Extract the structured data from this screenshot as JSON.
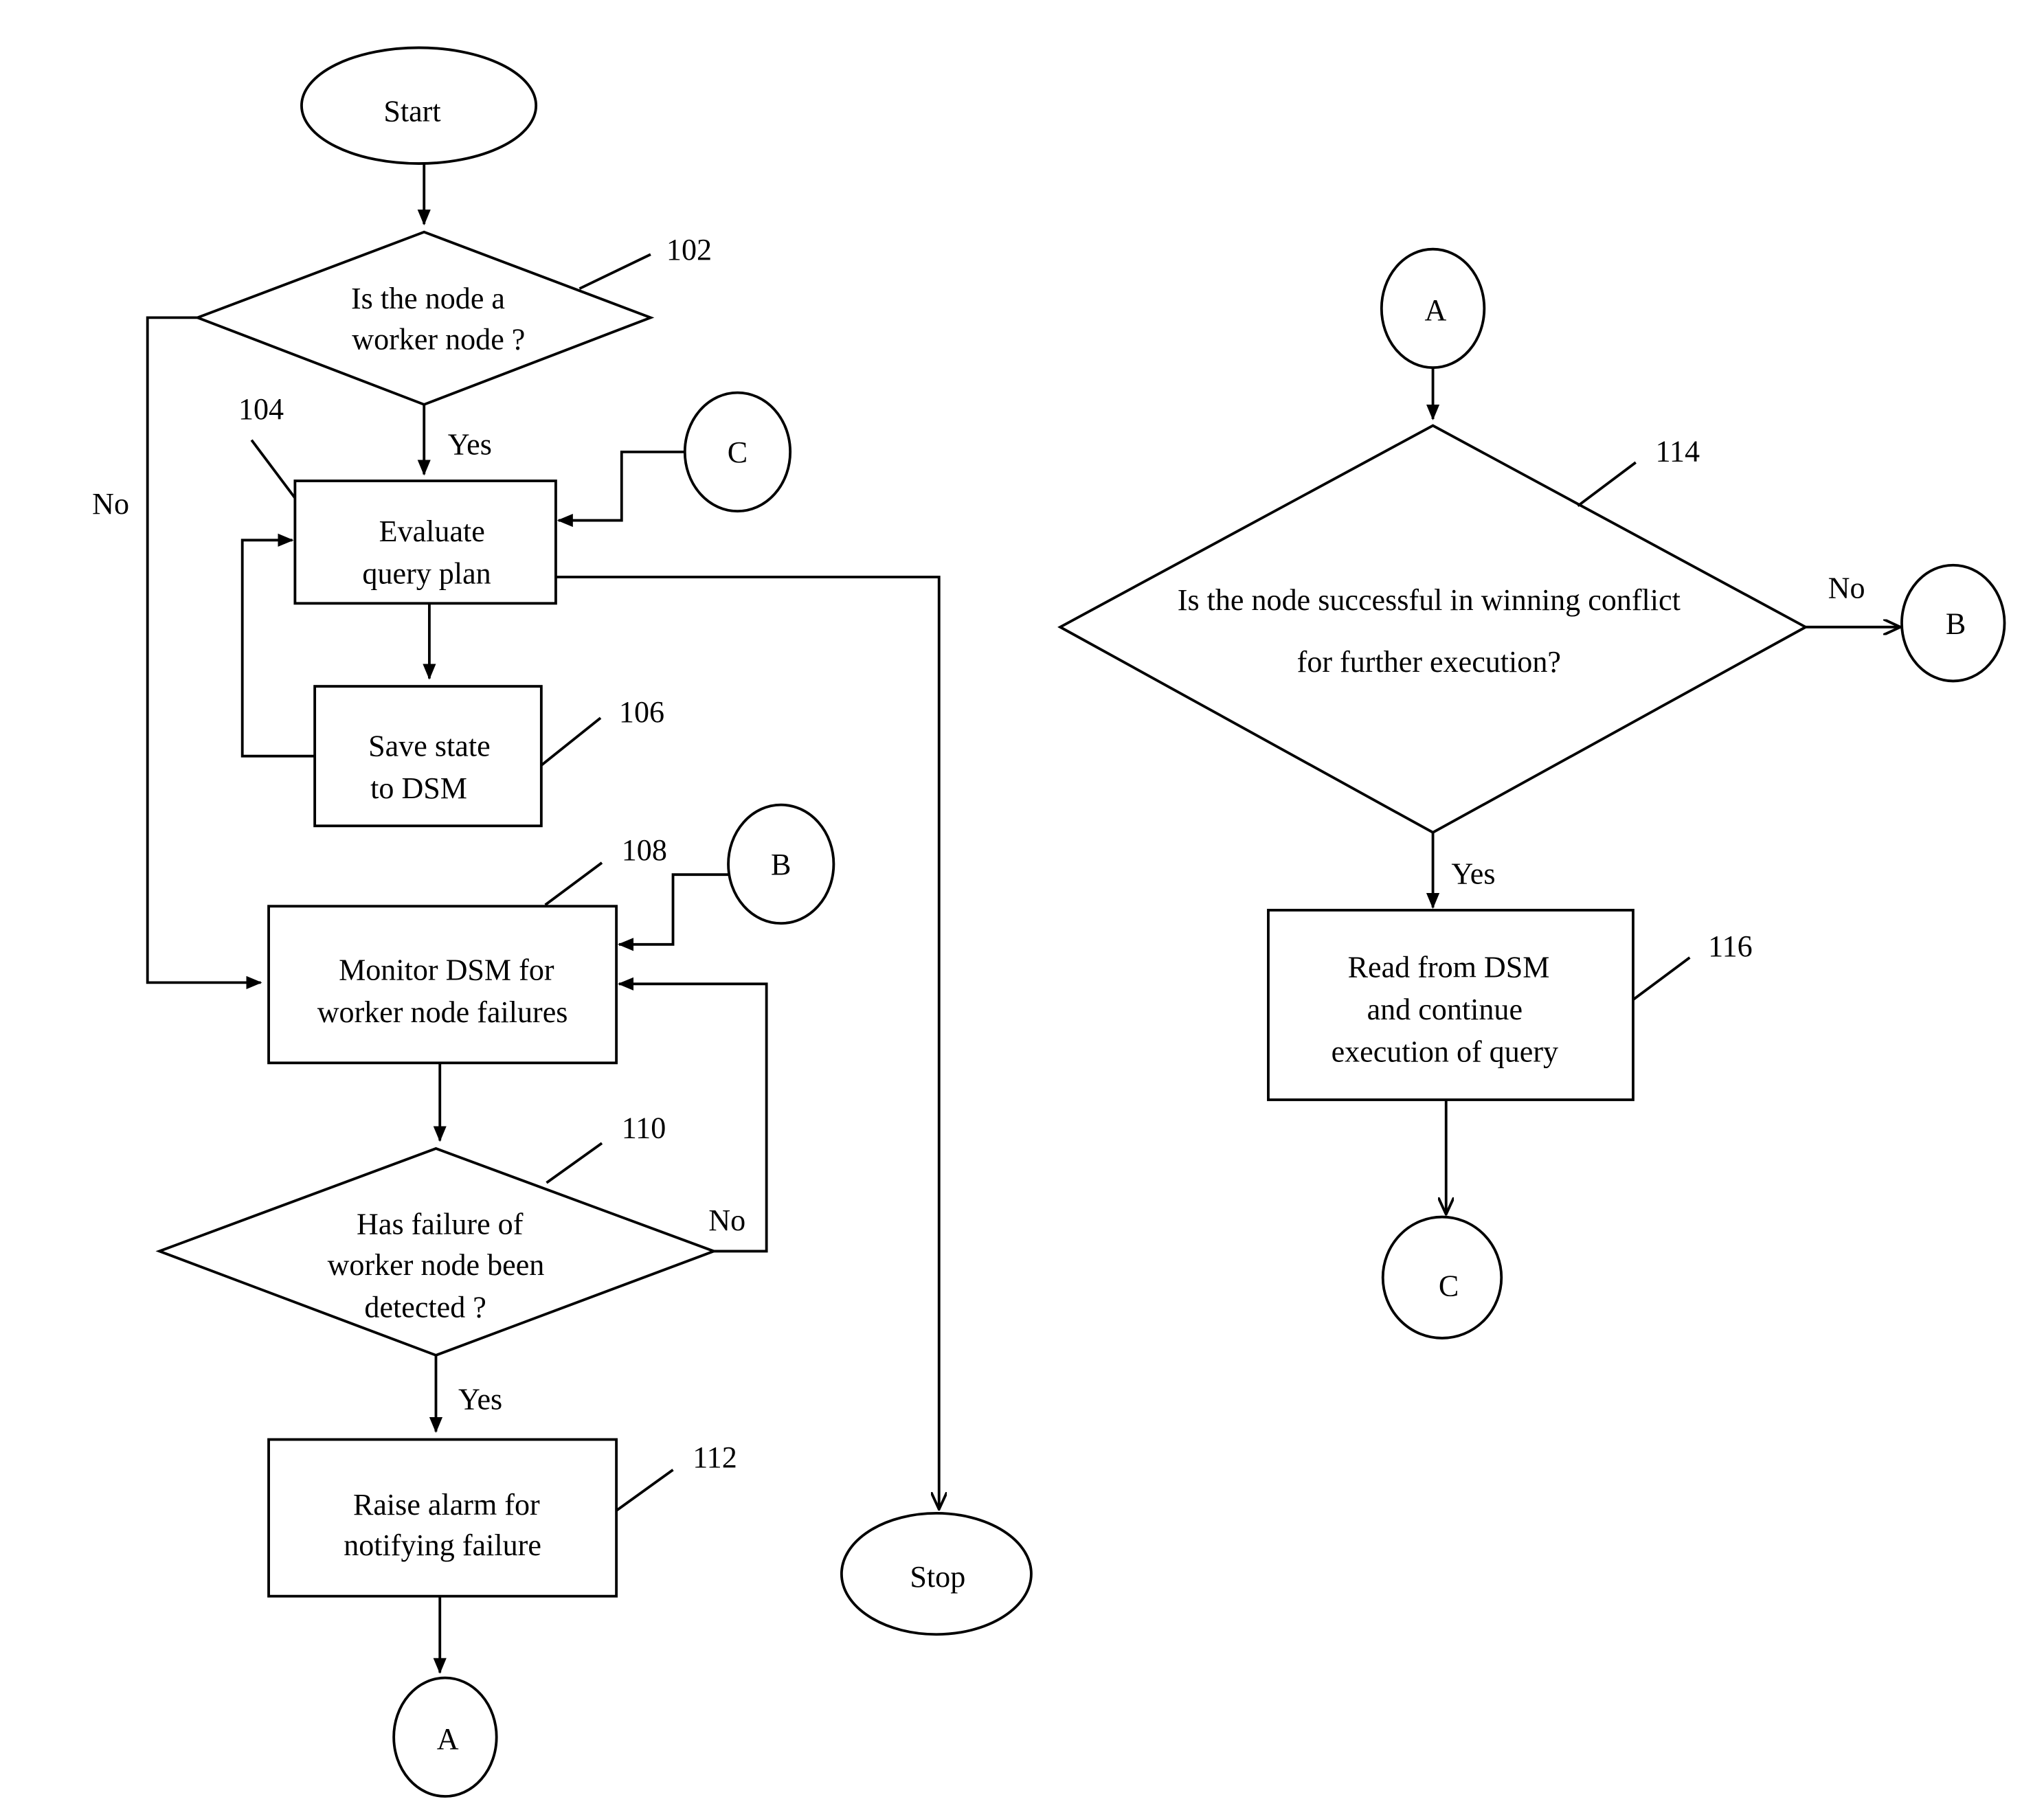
{
  "diagram": {
    "start": "Start",
    "stop": "Stop",
    "nodes": {
      "n102": {
        "ref": "102",
        "lines": [
          "Is the node a",
          "worker node ?"
        ]
      },
      "n104": {
        "ref": "104",
        "lines": [
          "Evaluate",
          "query plan"
        ]
      },
      "n106": {
        "ref": "106",
        "lines": [
          "Save state",
          "to  DSM"
        ]
      },
      "n108": {
        "ref": "108",
        "lines": [
          "Monitor DSM for",
          "worker node failures"
        ]
      },
      "n110": {
        "ref": "110",
        "lines": [
          "Has failure of",
          "worker node been",
          "detected ?"
        ]
      },
      "n112": {
        "ref": "112",
        "lines": [
          "Raise alarm for",
          "notifying failure"
        ]
      },
      "n114": {
        "ref": "114",
        "lines": [
          "Is the node successful in winning conflict",
          "for further execution?"
        ]
      },
      "n116": {
        "ref": "116",
        "lines": [
          "Read from DSM",
          "and continue",
          "execution of query"
        ]
      }
    },
    "connectors": {
      "a": "A",
      "b": "B",
      "c": "C"
    },
    "edge_labels": {
      "yes": "Yes",
      "no": "No"
    }
  }
}
